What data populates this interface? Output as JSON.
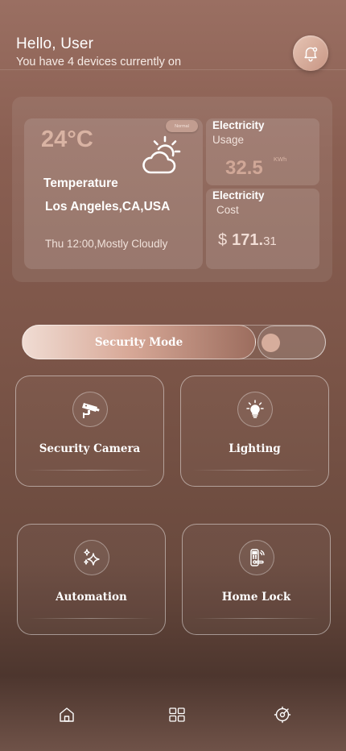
{
  "header": {
    "greeting": "Hello, User",
    "status": "You have 4 devices currently on",
    "bell_icon": "bell-icon"
  },
  "weather": {
    "temperature": "24°C",
    "badge": "Normal",
    "icon": "partly-cloudy-icon",
    "label": "Temperature",
    "location": "Los Angeles,CA,USA",
    "datetime": "Thu 12:00,Mostly Cloudly"
  },
  "usage": {
    "title": "Electricity",
    "subtitle": "Usage",
    "value": "32.5",
    "unit": "KWh"
  },
  "cost": {
    "title": "Electricity",
    "subtitle": "Cost",
    "currency": "$",
    "amount_int": "171.",
    "amount_dec": "31"
  },
  "security": {
    "label": "Security Mode",
    "enabled": false
  },
  "devices": [
    {
      "label": "Security Camera",
      "icon": "cctv-camera-icon"
    },
    {
      "label": "Lighting",
      "icon": "lightbulb-icon"
    },
    {
      "label": "Automation",
      "icon": "sparkles-icon"
    },
    {
      "label": "Home Lock",
      "icon": "smart-lock-icon"
    }
  ],
  "nav": [
    {
      "icon": "home-icon"
    },
    {
      "icon": "grid-icon"
    },
    {
      "icon": "settings-icon"
    }
  ],
  "colors": {
    "accent": "#d9b3a3",
    "background_top": "#9a6f62",
    "background_bottom": "#4d362e"
  }
}
